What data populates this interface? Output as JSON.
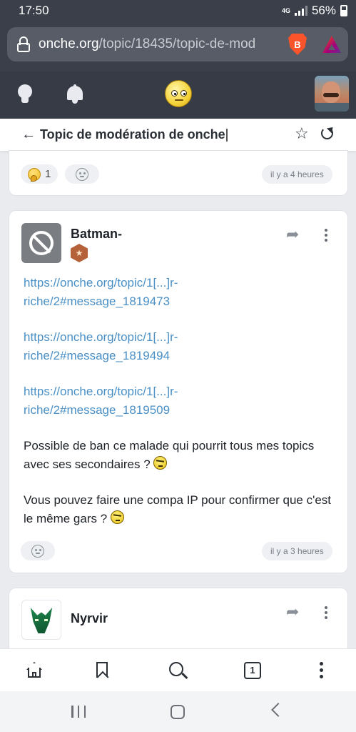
{
  "status_bar": {
    "time": "17:50",
    "network": "4G",
    "battery": "56%"
  },
  "browser": {
    "url_domain": "onche.org",
    "url_path": "/topic/18435/topic-de-mod",
    "brave_label": "B"
  },
  "topic": {
    "title": "Topic de modération de onche",
    "back_glyph": "←",
    "star_glyph": "☆"
  },
  "post_prev": {
    "reaction_count": "1",
    "time": "il y a 4 heures"
  },
  "post_main": {
    "username": "Batman-",
    "badge_glyph": "★",
    "links": [
      {
        "line1": "https://onche.org/topic/1[...]r-",
        "line2": "riche/2#message_1819473"
      },
      {
        "line1": "https://onche.org/topic/1[...]r-",
        "line2": "riche/2#message_1819494"
      },
      {
        "line1": "https://onche.org/topic/1[...]r-",
        "line2": "riche/2#message_1819509"
      }
    ],
    "paragraph1": "Possible de ban ce malade qui pourrit tous mes topics avec ses secondaires ?",
    "paragraph2": "Vous pouvez faire une compa IP pour confirmer que c'est le même gars ?",
    "time": "il y a 3 heures",
    "share_glyph": "➦"
  },
  "post_next": {
    "username": "Nyrvir",
    "share_glyph": "➦"
  },
  "toolbar": {
    "tabs_count": "1"
  },
  "colors": {
    "header_bg": "#363b46",
    "link": "#4a90c6",
    "page_bg": "#e9ebee"
  }
}
